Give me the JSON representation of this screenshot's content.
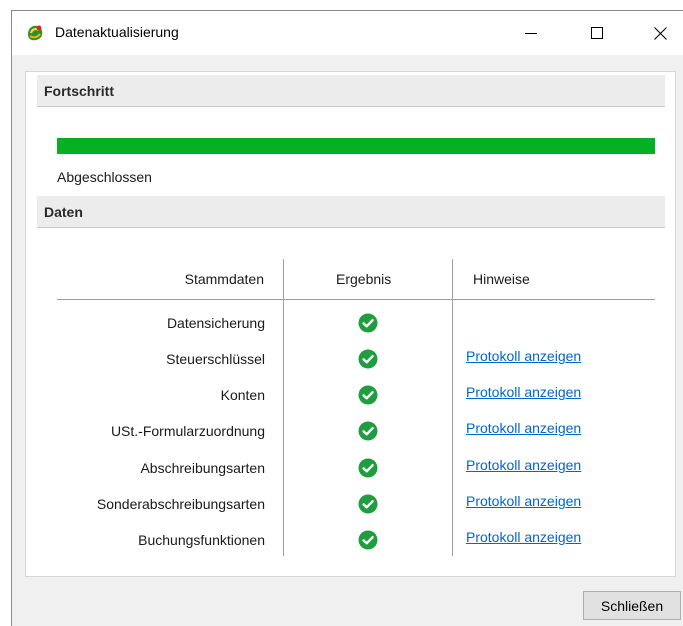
{
  "window": {
    "title": "Datenaktualisierung",
    "icon": "app-icon"
  },
  "progress": {
    "section_title": "Fortschritt",
    "fraction": 1.0,
    "color": "#06b025",
    "status": "Abgeschlossen"
  },
  "data": {
    "section_title": "Daten",
    "columns": {
      "stammdaten": "Stammdaten",
      "ergebnis": "Ergebnis",
      "hinweise": "Hinweise"
    },
    "rows": [
      {
        "label": "Datensicherung",
        "result": "check-icon",
        "link": ""
      },
      {
        "label": "Steuerschlüssel",
        "result": "check-icon",
        "link": "Protokoll anzeigen"
      },
      {
        "label": "Konten",
        "result": "check-icon",
        "link": "Protokoll anzeigen"
      },
      {
        "label": "USt.-Formularzuordnung",
        "result": "check-icon",
        "link": "Protokoll anzeigen"
      },
      {
        "label": "Abschreibungsarten",
        "result": "check-icon",
        "link": "Protokoll anzeigen"
      },
      {
        "label": "Sonderabschreibungsarten",
        "result": "check-icon",
        "link": "Protokoll anzeigen"
      },
      {
        "label": "Buchungsfunktionen",
        "result": "check-icon",
        "link": "Protokoll anzeigen"
      }
    ],
    "check_color": "#1e9e3e",
    "link_color": "#0066cc"
  },
  "footer": {
    "close_label": "Schließen"
  }
}
